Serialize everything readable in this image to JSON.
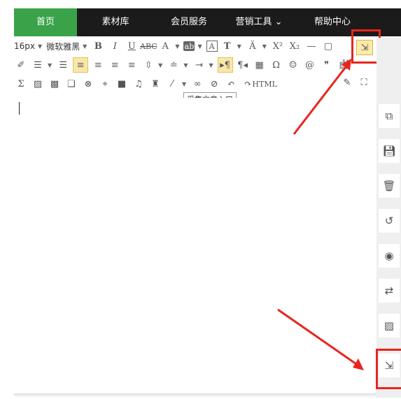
{
  "nav": {
    "tabs": [
      {
        "label": "首页",
        "active": true
      },
      {
        "label": "素材库"
      },
      {
        "label": "会员服务"
      },
      {
        "label": "营销工具 ⌄"
      },
      {
        "label": "帮助中心"
      }
    ]
  },
  "toolbar": {
    "font_size": "16px",
    "font_family": "微软雅黑",
    "tooltip": "采集文章入口"
  },
  "sidebar_icons": [
    "copy-icon",
    "save-icon",
    "trash-icon",
    "history-icon",
    "preview-icon",
    "swap-icon",
    "image-icon",
    "import-article-icon"
  ],
  "colors": {
    "nav_bg": "#1b1b1b",
    "nav_active": "#3aa34a",
    "highlight": "#e8251c"
  }
}
